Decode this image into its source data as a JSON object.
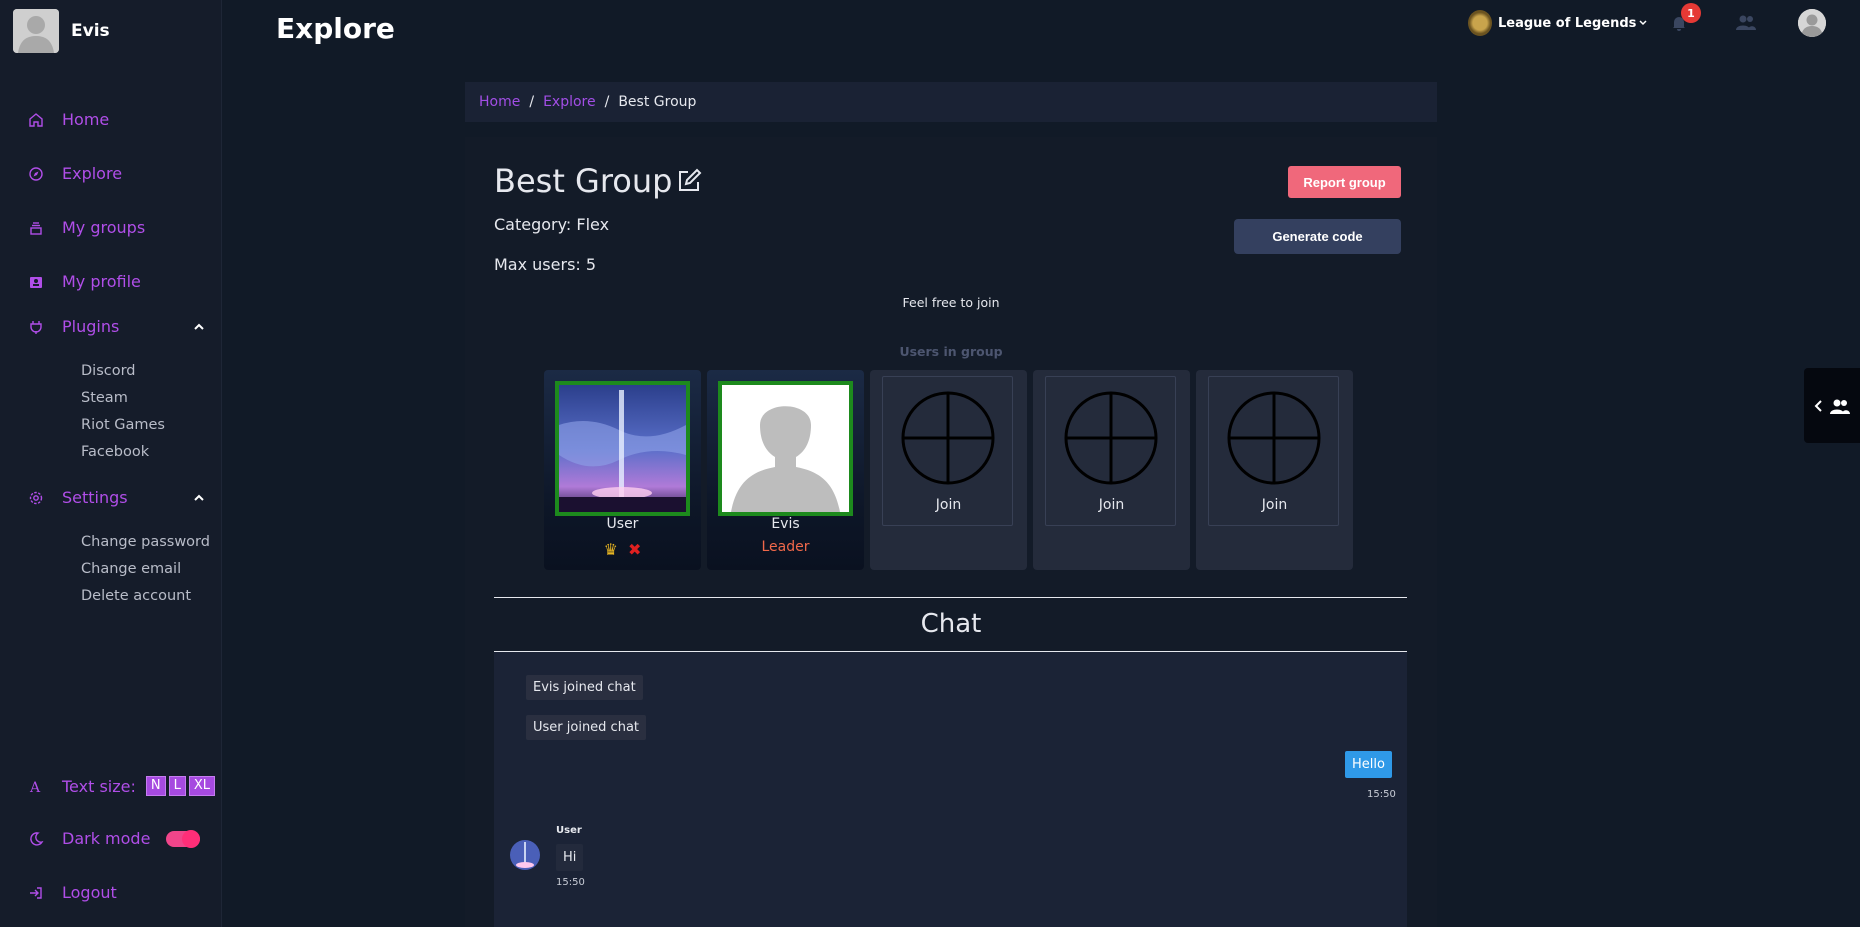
{
  "user": {
    "name": "Evis"
  },
  "nav": {
    "home": "Home",
    "explore": "Explore",
    "my_groups": "My groups",
    "my_profile": "My profile",
    "plugins": "Plugins",
    "plugins_items": [
      "Discord",
      "Steam",
      "Riot Games",
      "Facebook"
    ],
    "settings": "Settings",
    "settings_items": [
      "Change password",
      "Change email",
      "Delete account"
    ],
    "text_size": "Text size:",
    "text_size_options": [
      "N",
      "L",
      "XL"
    ],
    "dark_mode": "Dark mode",
    "dark_mode_on": true,
    "logout": "Logout"
  },
  "header": {
    "title": "Explore",
    "game": "League of Legends",
    "notification_count": "1"
  },
  "breadcrumb": {
    "home": "Home",
    "explore": "Explore",
    "current": "Best Group"
  },
  "group": {
    "title": "Best Group",
    "category": "Category: Flex",
    "max_users": "Max users: 5",
    "description": "Feel free to join",
    "report_label": "Report group",
    "generate_label": "Generate code",
    "users_heading": "Users in group",
    "members": [
      {
        "name": "User",
        "role": ""
      },
      {
        "name": "Evis",
        "role": "Leader"
      }
    ],
    "join_label": "Join"
  },
  "chat": {
    "title": "Chat",
    "system_messages": [
      "Evis joined chat",
      "User joined chat"
    ],
    "my_message": {
      "text": "Hello",
      "time": "15:50"
    },
    "their_message": {
      "author": "User",
      "text": "Hi",
      "time": "15:50"
    }
  },
  "colors": {
    "accent": "#a64ae0",
    "report": "#f0687b",
    "member_border": "#1d8a1d",
    "leader": "#f0684a",
    "my_bubble": "#2f99e8"
  }
}
